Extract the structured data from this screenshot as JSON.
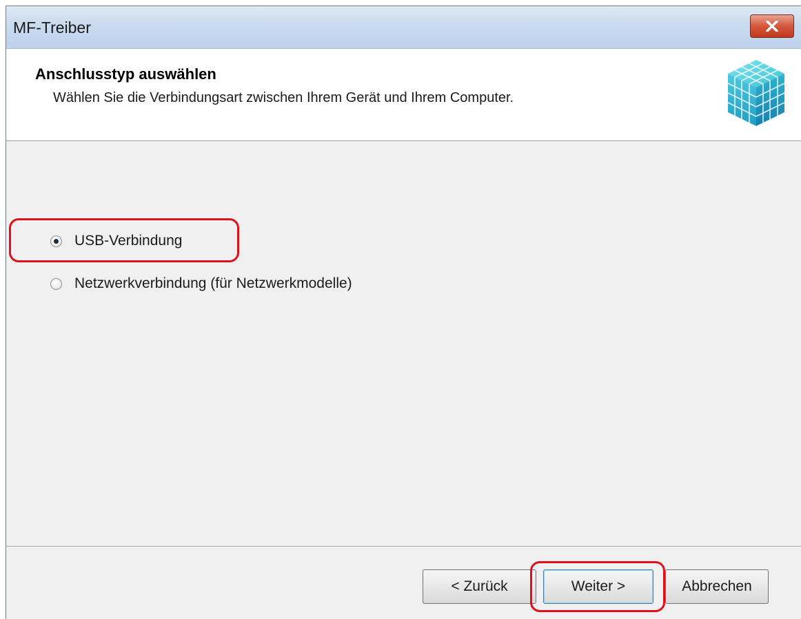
{
  "window": {
    "title": "MF-Treiber"
  },
  "header": {
    "title": "Anschlusstyp auswählen",
    "subtitle": "Wählen Sie die Verbindungsart zwischen Ihrem Gerät und Ihrem Computer."
  },
  "options": [
    {
      "label": "USB-Verbindung",
      "selected": true
    },
    {
      "label": "Netzwerkverbindung (für Netzwerkmodelle)",
      "selected": false
    }
  ],
  "buttons": {
    "back_label": "< Zurück",
    "next_label": "Weiter >",
    "cancel_label": "Abbrechen"
  },
  "icons": {
    "close": "close-icon",
    "product": "cube-icon"
  },
  "colors": {
    "highlight": "#e0101b",
    "titlebar": "#c9dbef",
    "close_button": "#d4573c",
    "cube": "#2bb7c9"
  }
}
